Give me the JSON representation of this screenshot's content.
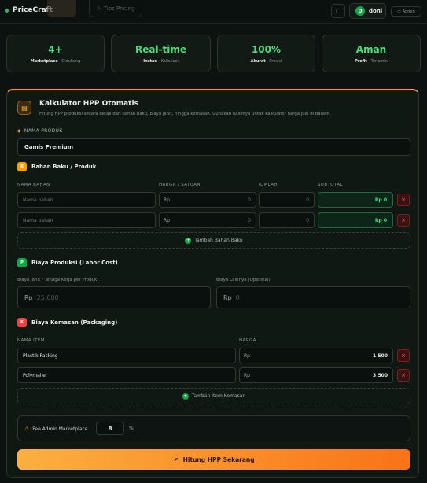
{
  "topbar": {
    "brand": "PriceCraft",
    "tips": "Tips Pricing",
    "user_name": "doni",
    "user_initial": "D",
    "admin": "Admin"
  },
  "stats": [
    {
      "value": "4+",
      "label_bold": "Marketplace",
      "label": " · Didukung"
    },
    {
      "value": "Real-time",
      "label_bold": "Instan",
      "label": " · Kalkulasi"
    },
    {
      "value": "100%",
      "label_bold": "Akurat",
      "label": " · Presisi"
    },
    {
      "value": "Aman",
      "label_bold": "Profit",
      "label": " · Terjamin"
    }
  ],
  "panel": {
    "title": "Kalkulator HPP Otomatis",
    "subtitle": "Hitung HPP produksi secara detail dari bahan baku, biaya jahit, hingga kemasan. Gunakan hasilnya untuk kalkulator harga jual di bawah."
  },
  "product": {
    "label": "NAMA PRODUK",
    "value": "Gamis Premium"
  },
  "materials": {
    "badge": "B",
    "title": "Bahan Baku / Produk",
    "columns": [
      "NAMA BAHAN",
      "HARGA / SATUAN",
      "JUMLAH",
      "SUBTOTAL"
    ],
    "rows": [
      {
        "name_placeholder": "Nama bahan",
        "currency": "Rp",
        "price": "0",
        "qty": "0",
        "subtotal": "Rp 0",
        "delete": "×"
      },
      {
        "name_placeholder": "Nama bahan",
        "currency": "Rp",
        "price": "0",
        "qty": "0",
        "subtotal": "Rp 0",
        "delete": "×"
      }
    ],
    "add": "Tambah Bahan Baku"
  },
  "labor": {
    "badge": "P",
    "title": "Biaya Produksi (Labor Cost)",
    "sewing_label": "Biaya Jahit / Tenaga Kerja per Produk",
    "sewing_currency": "Rp",
    "sewing_placeholder": "25.000",
    "other_label": "Biaya Lainnya (Opsional)",
    "other_currency": "Rp",
    "other_placeholder": "0"
  },
  "packaging": {
    "badge": "K",
    "title": "Biaya Kemasan (Packaging)",
    "columns": [
      "NAMA ITEM",
      "HARGA"
    ],
    "rows": [
      {
        "name": "Plastik Packing",
        "currency": "Rp",
        "price": "1.500",
        "delete": "×"
      },
      {
        "name": "Polymailer",
        "currency": "Rp",
        "price": "3.500",
        "delete": "×"
      }
    ],
    "add": "Tambah Item Kemasan"
  },
  "fee": {
    "label": "Fee Admin Marketplace",
    "value": "8",
    "unit": "%"
  },
  "cta": "Hitung HPP Sekarang",
  "icons": {
    "brand": "status-dot-icon",
    "tips": "lightbulb-icon",
    "theme": "moon-icon",
    "admin": "shield-icon",
    "panel": "calculator-icon",
    "product": "tag-icon",
    "fee": "warning-icon",
    "cta": "trending-up-icon"
  },
  "colors": {
    "accent": "#4ade80",
    "brand": "#22c55e",
    "warning": "#f59e0b",
    "cta_start": "#fbb040",
    "cta_end": "#f97316",
    "danger": "#f87171"
  }
}
